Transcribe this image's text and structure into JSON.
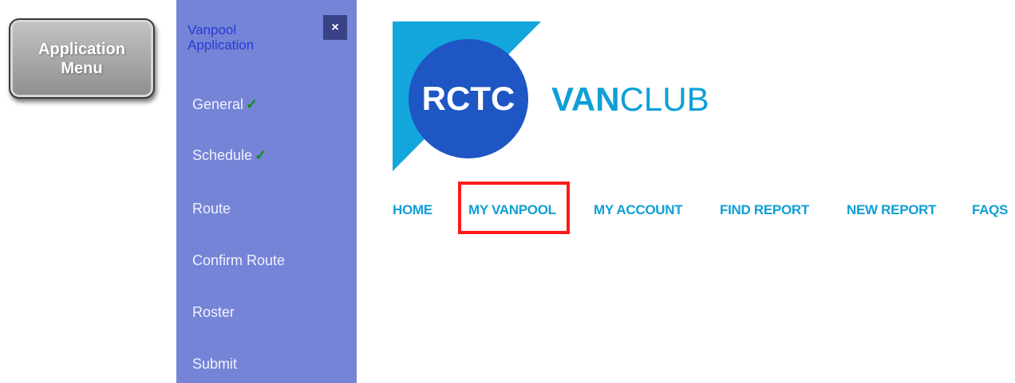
{
  "app_menu": {
    "label": "Application Menu"
  },
  "sidebar": {
    "title": "Vanpool Application",
    "close_symbol": "×",
    "items": [
      {
        "label": "General",
        "check": "✓"
      },
      {
        "label": "Schedule",
        "check": "✓"
      },
      {
        "label": "Route"
      },
      {
        "label": "Confirm Route"
      },
      {
        "label": "Roster"
      },
      {
        "label": "Submit"
      }
    ]
  },
  "logo": {
    "brand": "RCTC",
    "name_bold": "VAN",
    "name_light": "CLUB"
  },
  "nav": {
    "items": [
      "HOME",
      "MY VANPOOL",
      "MY ACCOUNT",
      "FIND REPORT",
      "NEW REPORT",
      "FAQS"
    ],
    "highlighted": "MY VANPOOL"
  },
  "colors": {
    "sidebar_bg": "#7584d6",
    "nav_text": "#0e9fd6",
    "logo_circle": "#1e56c4",
    "logo_triangle": "#13a6dc",
    "check": "#118c11",
    "highlight_border": "#ff1a1a"
  }
}
